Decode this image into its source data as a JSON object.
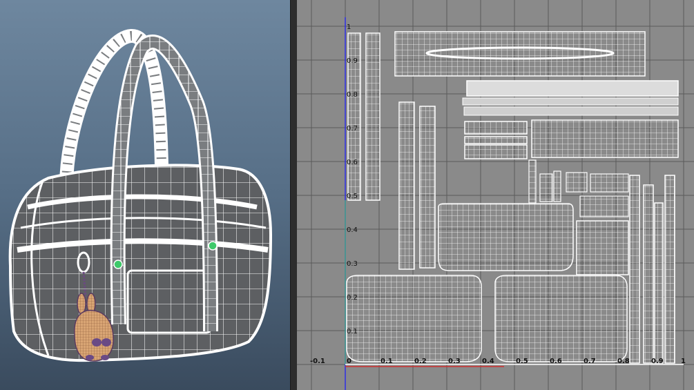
{
  "views": {
    "perspective": {
      "name": "perspective"
    },
    "uv_editor": {
      "name": "uv-editor"
    }
  },
  "uv": {
    "v_ticks": [
      "1",
      "0.9",
      "0.8",
      "0.7",
      "0.6",
      "0.5",
      "0.4",
      "0.3",
      "0.2",
      "0.1"
    ],
    "u_ticks": [
      "-0.1",
      "0",
      "0.1",
      "0.2",
      "0.3",
      "0.4",
      "0.5",
      "0.6",
      "0.7",
      "0.8",
      "0.9",
      "1"
    ],
    "v_values": [
      1,
      0.9,
      0.8,
      0.7,
      0.6,
      0.5,
      0.4,
      0.3,
      0.2,
      0.1
    ],
    "u_values": [
      -0.1,
      0,
      0.1,
      0.2,
      0.3,
      0.4,
      0.5,
      0.6,
      0.7,
      0.8,
      0.9,
      1
    ]
  },
  "colors": {
    "viewport_bg_top": "#6e879f",
    "viewport_bg_bottom": "#3a4b5e",
    "uv_bg": "#8a8a8a",
    "wire": "#ffffff",
    "v_axis": "#2e2ee6",
    "u_axis": "#d03030",
    "pivot": "#3ec96a"
  }
}
